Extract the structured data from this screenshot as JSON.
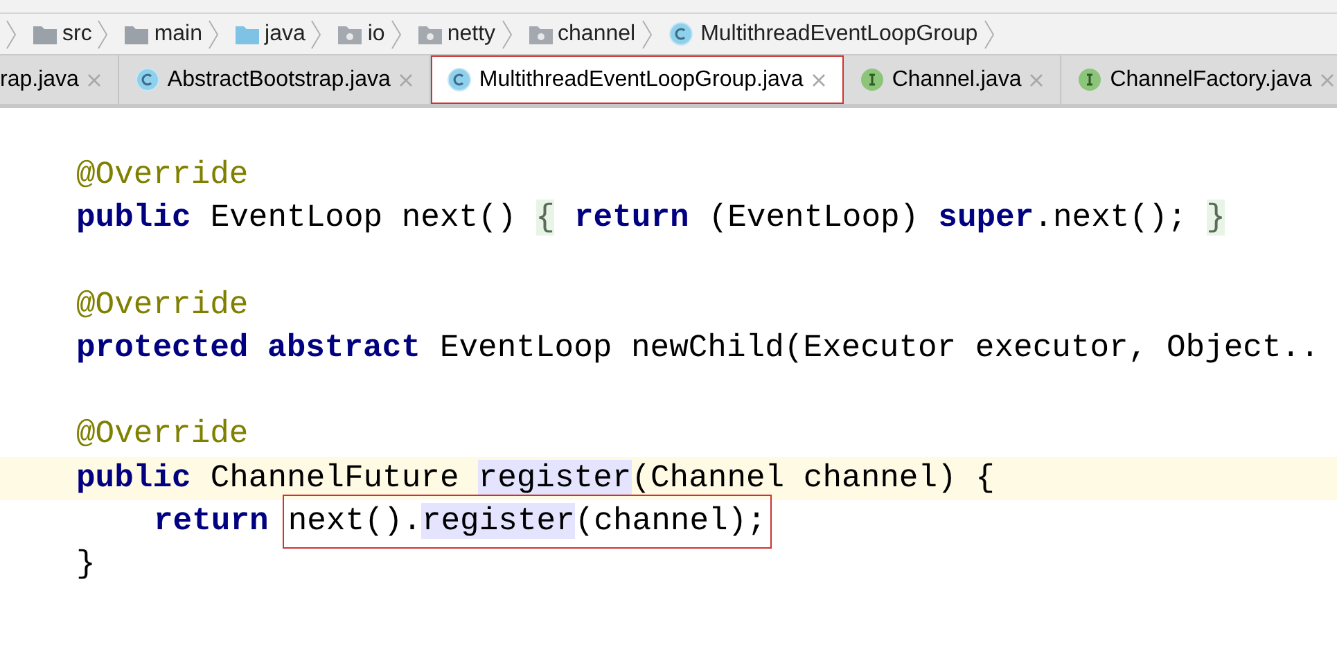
{
  "breadcrumbs": [
    {
      "label": "src",
      "kind": "folder"
    },
    {
      "label": "main",
      "kind": "folder"
    },
    {
      "label": "java",
      "kind": "source-folder"
    },
    {
      "label": "io",
      "kind": "package"
    },
    {
      "label": "netty",
      "kind": "package"
    },
    {
      "label": "channel",
      "kind": "package"
    },
    {
      "label": "MultithreadEventLoopGroup",
      "kind": "class"
    }
  ],
  "tabs": [
    {
      "label": "rap.java",
      "kind": "plain",
      "selected": false,
      "outlined": false
    },
    {
      "label": "AbstractBootstrap.java",
      "kind": "class",
      "selected": false,
      "outlined": false
    },
    {
      "label": "MultithreadEventLoopGroup.java",
      "kind": "class",
      "selected": true,
      "outlined": true
    },
    {
      "label": "Channel.java",
      "kind": "interface",
      "selected": false,
      "outlined": false
    },
    {
      "label": "ChannelFactory.java",
      "kind": "interface",
      "selected": false,
      "outlined": false
    }
  ],
  "code_lines": [
    {
      "caret_line": false
    },
    {
      "caret_line": false,
      "tokens": [
        {
          "kind": "annotation",
          "text": "@Override"
        }
      ]
    },
    {
      "caret_line": false,
      "tokens": [
        {
          "kind": "keyword",
          "text": "public"
        },
        {
          "kind": "plain",
          "text": "EventLoop next()"
        },
        {
          "kind": "folded",
          "text": "{"
        },
        {
          "kind": "keyword",
          "text": "return"
        },
        {
          "kind": "plain",
          "text": "(EventLoop)"
        },
        {
          "kind": "keyword",
          "text": "super"
        },
        {
          "kind": "joined",
          "text": ".next();"
        },
        {
          "kind": "folded",
          "text": "}"
        }
      ]
    },
    {
      "caret_line": false
    },
    {
      "caret_line": false,
      "tokens": [
        {
          "kind": "annotation",
          "text": "@Override"
        }
      ]
    },
    {
      "caret_line": false,
      "tokens": [
        {
          "kind": "keyword",
          "text": "protected abstract"
        },
        {
          "kind": "plain",
          "text": "EventLoop newChild(Executor executor, Object.."
        }
      ]
    },
    {
      "caret_line": false
    },
    {
      "caret_line": false,
      "tokens": [
        {
          "kind": "annotation",
          "text": "@Override"
        }
      ]
    },
    {
      "caret_line": true,
      "tokens": [
        {
          "kind": "keyword",
          "text": "public"
        },
        {
          "kind": "plain",
          "text": "ChannelFuture"
        },
        {
          "kind": "usage",
          "text": "register"
        },
        {
          "kind": "joined",
          "text": "(Channel channel) {"
        }
      ]
    },
    {
      "caret_line": false,
      "indented": true,
      "tokens": [
        {
          "kind": "keyword",
          "text": "return"
        },
        {
          "kind": "outlined",
          "parts": [
            {
              "kind": "plain",
              "text": "next()."
            },
            {
              "kind": "usage",
              "text": "register"
            },
            {
              "kind": "plain",
              "text": "(channel);"
            }
          ]
        }
      ]
    },
    {
      "caret_line": false,
      "tokens": [
        {
          "kind": "plain",
          "text": "}"
        }
      ]
    },
    {
      "caret_line": false
    }
  ]
}
